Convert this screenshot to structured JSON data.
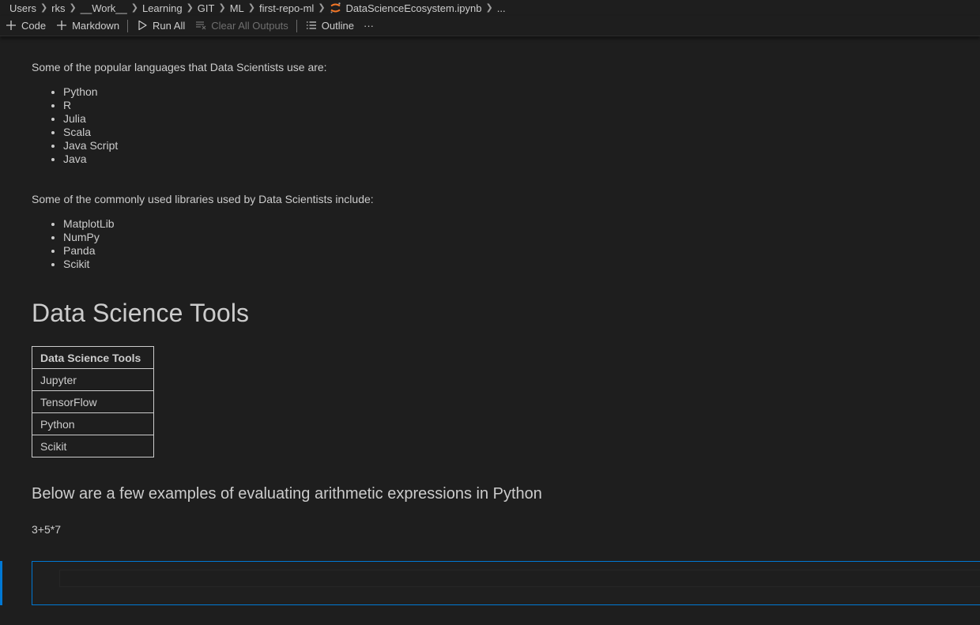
{
  "breadcrumb": {
    "items": [
      "Users",
      "rks",
      "__Work__",
      "Learning",
      "GIT",
      "ML",
      "first-repo-ml"
    ],
    "file": "DataScienceEcosystem.ipynb",
    "more": "..."
  },
  "toolbar": {
    "code_label": "Code",
    "markdown_label": "Markdown",
    "run_all_label": "Run All",
    "clear_outputs_label": "Clear All Outputs",
    "outline_label": "Outline",
    "more_label": "···"
  },
  "notebook": {
    "languages_intro": "Some of the popular languages that Data Scientists use are:",
    "languages": [
      "Python",
      "R",
      "Julia",
      "Scala",
      "Java Script",
      "Java"
    ],
    "libraries_intro": "Some of the commonly used libraries used by Data Scientists include:",
    "libraries": [
      "MatplotLib",
      "NumPy",
      "Panda",
      "Scikit"
    ],
    "tools_heading": "Data Science Tools",
    "tools_table": {
      "header": "Data Science Tools",
      "rows": [
        "Jupyter",
        "TensorFlow",
        "Python",
        "Scikit"
      ]
    },
    "arithmetic_heading": "Below are a few examples of evaluating arithmetic expressions in Python",
    "expression": "3+5*7"
  },
  "colors": {
    "background": "#1e1e1e",
    "text": "#cccccc",
    "accent": "#0078d4",
    "jupyter_icon": "#f37626"
  },
  "icons": {
    "notebook": "jupyter-notebook-icon",
    "add": "plus-icon",
    "run": "play-outline-icon",
    "clear": "clear-outputs-icon",
    "outline": "list-icon",
    "more": "ellipsis-icon"
  }
}
